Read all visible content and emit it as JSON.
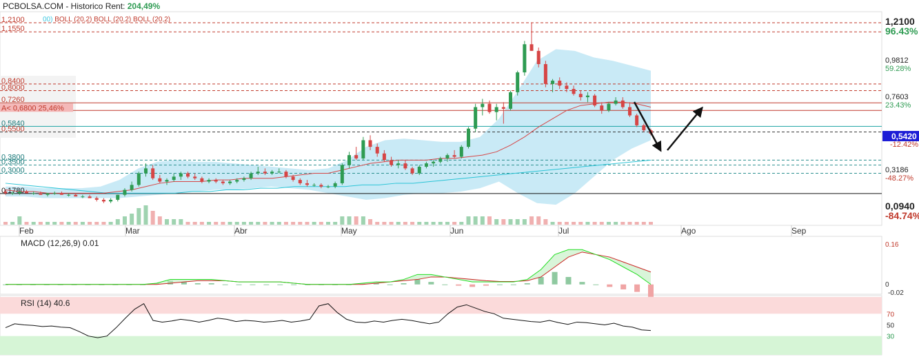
{
  "header": {
    "source": "PCBOLSA.COM - Historico",
    "rent_label": "Rent:",
    "rent_value": "204,49%"
  },
  "legend": {
    "cyan_fragment": "00)",
    "boll_labels": [
      "BOLL (20,2)",
      "BOLL (20,2)",
      "BOLL (20,2)"
    ]
  },
  "colors": {
    "up_candle": "#2e9b52",
    "down_candle": "#d64545",
    "boll_fill": "#bfe6f5",
    "ma_red": "#d64545",
    "ma_cyan": "#29c4d6",
    "macd_green": "#22dd22",
    "macd_red": "#cc2222",
    "current_price_bg": "#1d1dd6"
  },
  "chart_data": [
    {
      "type": "candlestick",
      "title": "",
      "x_months": [
        "Feb",
        "Mar",
        "Abr",
        "May",
        "Jun",
        "Jul",
        "Ago",
        "Sep"
      ],
      "y_ticks": [
        {
          "value": "1,2100",
          "pct": "96.43%"
        },
        {
          "value": "0,9812",
          "pct": "59.28%"
        },
        {
          "value": "0,7603",
          "pct": "23.43%"
        },
        {
          "value": "0,3186",
          "pct": "-48.27%"
        },
        {
          "value": "0,0940",
          "pct": "-84.74%"
        }
      ],
      "current_price": "0,5420",
      "current_pct_partial": "-12.42%",
      "current_price_obscured": "0,5420",
      "levels": [
        {
          "label": "1,2100",
          "value": 1.21,
          "style": "dashed-red"
        },
        {
          "label": "1,1550",
          "value": 1.155,
          "style": "dashed-red"
        },
        {
          "label": "0,8400",
          "value": 0.84,
          "style": "dashed-red"
        },
        {
          "label": "0,8000",
          "value": 0.8,
          "style": "dashed-red"
        },
        {
          "label": "0,7260",
          "value": 0.726,
          "style": "solid-red"
        },
        {
          "label": "0,6800",
          "value": 0.68,
          "style": "solid-red-marked",
          "tag": "A<",
          "pct": "25,46%"
        },
        {
          "label": "0,5840",
          "value": 0.584,
          "style": "solid-teal"
        },
        {
          "label": "0,5500",
          "value": 0.55,
          "style": "dashed-dark"
        },
        {
          "label": "0,3800",
          "value": 0.38,
          "style": "dashed-teal"
        },
        {
          "label": "0,3500",
          "value": 0.35,
          "style": "dashed-teal"
        },
        {
          "label": "0,3000",
          "value": 0.3,
          "style": "dashed-teal"
        },
        {
          "label": "0,1780",
          "value": 0.178,
          "style": "solid-black"
        }
      ],
      "candles": [
        [
          0.19,
          0.2,
          0.17,
          0.18
        ],
        [
          0.18,
          0.19,
          0.17,
          0.18
        ],
        [
          0.18,
          0.19,
          0.17,
          0.19
        ],
        [
          0.19,
          0.2,
          0.18,
          0.18
        ],
        [
          0.18,
          0.19,
          0.17,
          0.18
        ],
        [
          0.18,
          0.19,
          0.17,
          0.17
        ],
        [
          0.17,
          0.18,
          0.16,
          0.18
        ],
        [
          0.18,
          0.19,
          0.17,
          0.18
        ],
        [
          0.18,
          0.19,
          0.17,
          0.17
        ],
        [
          0.17,
          0.18,
          0.16,
          0.17
        ],
        [
          0.17,
          0.18,
          0.16,
          0.16
        ],
        [
          0.16,
          0.17,
          0.15,
          0.16
        ],
        [
          0.16,
          0.17,
          0.15,
          0.15
        ],
        [
          0.15,
          0.16,
          0.13,
          0.14
        ],
        [
          0.14,
          0.15,
          0.12,
          0.13
        ],
        [
          0.13,
          0.15,
          0.12,
          0.14
        ],
        [
          0.14,
          0.17,
          0.13,
          0.17
        ],
        [
          0.17,
          0.21,
          0.16,
          0.2
        ],
        [
          0.2,
          0.25,
          0.19,
          0.23
        ],
        [
          0.23,
          0.31,
          0.22,
          0.3
        ],
        [
          0.3,
          0.36,
          0.28,
          0.33
        ],
        [
          0.33,
          0.35,
          0.26,
          0.27
        ],
        [
          0.27,
          0.29,
          0.24,
          0.25
        ],
        [
          0.25,
          0.27,
          0.23,
          0.26
        ],
        [
          0.26,
          0.3,
          0.25,
          0.28
        ],
        [
          0.28,
          0.31,
          0.26,
          0.3
        ],
        [
          0.3,
          0.31,
          0.27,
          0.28
        ],
        [
          0.28,
          0.3,
          0.26,
          0.27
        ],
        [
          0.27,
          0.28,
          0.24,
          0.25
        ],
        [
          0.25,
          0.27,
          0.24,
          0.26
        ],
        [
          0.26,
          0.27,
          0.24,
          0.25
        ],
        [
          0.25,
          0.26,
          0.23,
          0.24
        ],
        [
          0.24,
          0.26,
          0.23,
          0.25
        ],
        [
          0.25,
          0.27,
          0.24,
          0.26
        ],
        [
          0.26,
          0.28,
          0.25,
          0.27
        ],
        [
          0.27,
          0.31,
          0.26,
          0.3
        ],
        [
          0.3,
          0.34,
          0.29,
          0.31
        ],
        [
          0.31,
          0.33,
          0.29,
          0.3
        ],
        [
          0.3,
          0.32,
          0.29,
          0.31
        ],
        [
          0.31,
          0.33,
          0.3,
          0.31
        ],
        [
          0.31,
          0.32,
          0.27,
          0.28
        ],
        [
          0.28,
          0.29,
          0.25,
          0.26
        ],
        [
          0.26,
          0.27,
          0.23,
          0.24
        ],
        [
          0.24,
          0.26,
          0.22,
          0.23
        ],
        [
          0.23,
          0.24,
          0.22,
          0.23
        ],
        [
          0.23,
          0.24,
          0.21,
          0.22
        ],
        [
          0.22,
          0.23,
          0.21,
          0.22
        ],
        [
          0.22,
          0.25,
          0.21,
          0.24
        ],
        [
          0.24,
          0.36,
          0.23,
          0.35
        ],
        [
          0.35,
          0.43,
          0.33,
          0.41
        ],
        [
          0.41,
          0.46,
          0.38,
          0.39
        ],
        [
          0.39,
          0.52,
          0.38,
          0.5
        ],
        [
          0.5,
          0.53,
          0.44,
          0.46
        ],
        [
          0.46,
          0.48,
          0.4,
          0.42
        ],
        [
          0.42,
          0.44,
          0.37,
          0.38
        ],
        [
          0.38,
          0.4,
          0.34,
          0.35
        ],
        [
          0.35,
          0.38,
          0.33,
          0.36
        ],
        [
          0.36,
          0.38,
          0.32,
          0.33
        ],
        [
          0.33,
          0.34,
          0.29,
          0.3
        ],
        [
          0.3,
          0.35,
          0.29,
          0.34
        ],
        [
          0.34,
          0.37,
          0.33,
          0.36
        ],
        [
          0.36,
          0.38,
          0.34,
          0.37
        ],
        [
          0.37,
          0.4,
          0.36,
          0.39
        ],
        [
          0.39,
          0.42,
          0.37,
          0.41
        ],
        [
          0.41,
          0.44,
          0.39,
          0.4
        ],
        [
          0.4,
          0.47,
          0.39,
          0.46
        ],
        [
          0.46,
          0.58,
          0.45,
          0.57
        ],
        [
          0.57,
          0.72,
          0.55,
          0.7
        ],
        [
          0.7,
          0.75,
          0.65,
          0.72
        ],
        [
          0.72,
          0.74,
          0.66,
          0.67
        ],
        [
          0.67,
          0.72,
          0.62,
          0.7
        ],
        [
          0.7,
          0.73,
          0.6,
          0.69
        ],
        [
          0.69,
          0.8,
          0.68,
          0.79
        ],
        [
          0.79,
          0.92,
          0.77,
          0.91
        ],
        [
          0.91,
          1.1,
          0.89,
          1.08
        ],
        [
          1.08,
          1.21,
          1.04,
          1.04
        ],
        [
          1.04,
          1.06,
          0.94,
          0.96
        ],
        [
          0.96,
          0.98,
          0.82,
          0.84
        ],
        [
          0.84,
          0.87,
          0.79,
          0.86
        ],
        [
          0.86,
          0.88,
          0.81,
          0.83
        ],
        [
          0.83,
          0.85,
          0.79,
          0.81
        ],
        [
          0.81,
          0.83,
          0.77,
          0.78
        ],
        [
          0.78,
          0.8,
          0.74,
          0.76
        ],
        [
          0.76,
          0.79,
          0.73,
          0.77
        ],
        [
          0.77,
          0.78,
          0.7,
          0.71
        ],
        [
          0.71,
          0.73,
          0.66,
          0.68
        ],
        [
          0.68,
          0.73,
          0.67,
          0.72
        ],
        [
          0.72,
          0.76,
          0.71,
          0.74
        ],
        [
          0.74,
          0.76,
          0.69,
          0.7
        ],
        [
          0.7,
          0.73,
          0.64,
          0.65
        ],
        [
          0.65,
          0.66,
          0.58,
          0.59
        ],
        [
          0.59,
          0.6,
          0.55,
          0.56
        ],
        [
          0.56,
          0.57,
          0.53,
          0.54
        ]
      ],
      "ma_red": [
        0.2,
        0.19,
        0.19,
        0.18,
        0.18,
        0.18,
        0.18,
        0.18,
        0.19,
        0.2,
        0.22,
        0.24,
        0.25,
        0.25,
        0.25,
        0.26,
        0.26,
        0.27,
        0.27,
        0.27,
        0.28,
        0.29,
        0.3,
        0.3,
        0.32,
        0.34,
        0.36,
        0.37,
        0.38,
        0.38,
        0.38,
        0.39,
        0.39,
        0.4,
        0.41,
        0.43,
        0.47,
        0.52,
        0.58,
        0.63,
        0.68,
        0.71,
        0.72,
        0.73,
        0.73,
        0.72,
        0.7
      ],
      "ma_cyan": [
        0.24,
        0.23,
        0.22,
        0.21,
        0.2,
        0.19,
        0.18,
        0.18,
        0.18,
        0.18,
        0.18,
        0.19,
        0.19,
        0.2,
        0.2,
        0.21,
        0.21,
        0.22,
        0.22,
        0.22,
        0.22,
        0.23,
        0.23,
        0.24,
        0.24,
        0.25,
        0.26,
        0.27,
        0.28,
        0.29,
        0.3,
        0.31,
        0.32,
        0.33,
        0.34,
        0.35,
        0.36,
        0.37,
        0.38
      ],
      "boll_upper": [
        0.22,
        0.22,
        0.21,
        0.21,
        0.21,
        0.22,
        0.26,
        0.33,
        0.37,
        0.38,
        0.37,
        0.37,
        0.36,
        0.35,
        0.34,
        0.33,
        0.32,
        0.33,
        0.38,
        0.46,
        0.5,
        0.51,
        0.5,
        0.49,
        0.49,
        0.52,
        0.63,
        0.8,
        0.98,
        1.05,
        1.04,
        1.0,
        0.98,
        0.95,
        0.92
      ],
      "boll_lower": [
        0.16,
        0.16,
        0.15,
        0.15,
        0.15,
        0.15,
        0.15,
        0.16,
        0.17,
        0.18,
        0.19,
        0.2,
        0.2,
        0.21,
        0.22,
        0.21,
        0.2,
        0.18,
        0.16,
        0.14,
        0.15,
        0.17,
        0.18,
        0.18,
        0.19,
        0.21,
        0.25,
        0.18,
        0.12,
        0.11,
        0.18,
        0.28,
        0.38,
        0.45,
        0.5
      ],
      "volume": [
        1,
        1,
        3,
        1,
        1,
        1,
        1,
        1,
        1,
        1,
        1,
        1,
        1,
        1,
        1,
        1,
        2,
        3,
        4,
        6,
        7,
        5,
        3,
        2,
        2,
        2,
        1,
        1,
        1,
        1,
        1,
        1,
        1,
        1,
        1,
        1,
        1,
        1,
        1,
        1,
        1,
        1,
        1,
        1,
        1,
        1,
        1,
        1,
        3,
        3,
        3,
        3,
        2,
        1,
        1,
        1,
        1,
        1,
        1,
        1,
        1,
        1,
        1,
        1,
        1,
        1,
        3,
        3,
        3,
        3,
        2,
        2,
        2,
        2,
        2,
        3,
        3,
        2,
        1,
        1,
        1,
        1,
        1,
        1,
        1,
        1,
        1,
        1,
        1,
        1,
        1,
        1,
        1
      ]
    },
    {
      "type": "line",
      "title": "MACD (12,26,9) 0.01",
      "y_ticks": [
        "0.16",
        "0",
        "-0.02"
      ],
      "macd_line": [
        0.0,
        0.0,
        0.0,
        0.0,
        0.0,
        0.0,
        0.0,
        0.0,
        0.0,
        0.0,
        0.0,
        0.005,
        0.02,
        0.02,
        0.02,
        0.02,
        0.015,
        0.01,
        0.01,
        0.01,
        0.01,
        0.005,
        0.0,
        0.0,
        0.0,
        0.0,
        0.005,
        0.01,
        0.01,
        0.02,
        0.04,
        0.04,
        0.03,
        0.02,
        0.01,
        0.01,
        0.01,
        0.01,
        0.02,
        0.06,
        0.12,
        0.14,
        0.14,
        0.12,
        0.1,
        0.07,
        0.04,
        0.0
      ],
      "signal_line": [
        0.0,
        0.0,
        0.0,
        0.0,
        0.0,
        0.0,
        0.0,
        0.0,
        0.0,
        0.0,
        0.0,
        0.0,
        0.005,
        0.01,
        0.015,
        0.015,
        0.015,
        0.01,
        0.01,
        0.01,
        0.01,
        0.005,
        0.0,
        0.0,
        0.0,
        0.0,
        0.0,
        0.005,
        0.01,
        0.015,
        0.02,
        0.03,
        0.03,
        0.025,
        0.02,
        0.015,
        0.012,
        0.012,
        0.015,
        0.03,
        0.07,
        0.11,
        0.13,
        0.12,
        0.11,
        0.09,
        0.07,
        0.05
      ],
      "histogram": [
        0,
        0,
        0,
        0,
        0,
        0,
        0,
        0,
        0,
        0,
        0,
        0.005,
        0.015,
        0.01,
        0.005,
        0.005,
        0,
        0,
        0,
        0,
        0,
        0,
        0,
        0,
        0,
        0,
        0.005,
        0.005,
        0,
        0.005,
        0.02,
        0.01,
        0,
        -0.005,
        -0.01,
        -0.005,
        0,
        0,
        0.005,
        0.03,
        0.05,
        0.03,
        0.01,
        0,
        -0.01,
        -0.02,
        -0.03,
        -0.05
      ]
    },
    {
      "type": "line",
      "title": "RSI (14) 40.6",
      "y_ticks": [
        "70",
        "50",
        "30"
      ],
      "values": [
        45,
        52,
        50,
        49,
        47,
        48,
        46,
        45,
        38,
        30,
        27,
        30,
        45,
        62,
        78,
        88,
        58,
        55,
        57,
        60,
        58,
        55,
        58,
        62,
        60,
        56,
        58,
        57,
        55,
        56,
        58,
        55,
        57,
        60,
        84,
        88,
        72,
        60,
        55,
        54,
        57,
        55,
        58,
        60,
        58,
        55,
        52,
        55,
        70,
        82,
        86,
        80,
        74,
        70,
        62,
        60,
        58,
        56,
        55,
        58,
        54,
        51,
        55,
        54,
        52,
        50,
        53,
        48,
        46,
        41,
        40
      ]
    }
  ],
  "x_axis": {
    "months": [
      "Feb",
      "Mar",
      "Abr",
      "May",
      "Jun",
      "Jul",
      "Ago",
      "Sep"
    ]
  }
}
